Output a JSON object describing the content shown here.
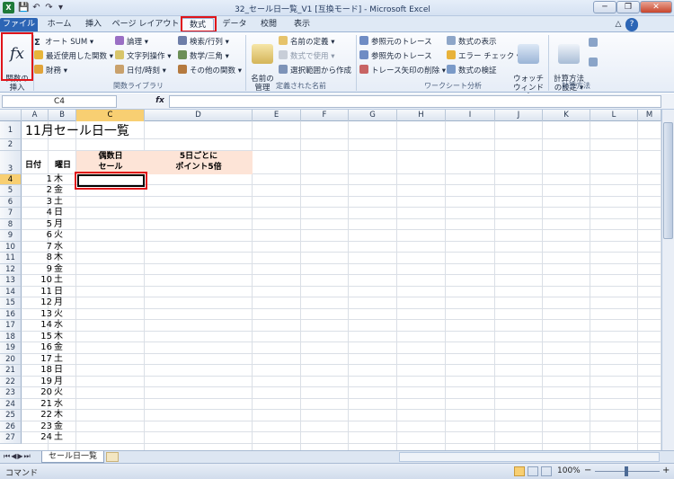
{
  "window": {
    "title": "32_セール日一覧_V1 [互換モード] - Microsoft Excel",
    "app_icon": "X"
  },
  "qat": {
    "save": "💾",
    "undo": "↶",
    "redo": "↷",
    "customize": "▾"
  },
  "window_controls": {
    "help": "?",
    "minimize_ribbon": "△",
    "min": "─",
    "max": "❐",
    "close": "✕"
  },
  "tabs": [
    "ファイル",
    "ホーム",
    "挿入",
    "ページ レイアウト",
    "数式",
    "データ",
    "校閲",
    "表示"
  ],
  "ribbon": {
    "insert_function": "関数の\n挿入",
    "library": {
      "autosum": "オート SUM ▾",
      "recent": "最近使用した関数 ▾",
      "financial": "財務 ▾",
      "logical": "論理 ▾",
      "text": "文字列操作 ▾",
      "datetime": "日付/時刻 ▾",
      "lookup": "検索/行列 ▾",
      "math": "数学/三角 ▾",
      "more": "その他の関数 ▾",
      "label": "関数ライブラリ"
    },
    "names": {
      "manager": "名前の\n管理",
      "define": "名前の定義 ▾",
      "use_in_formula": "数式で使用 ▾",
      "create_from_selection": "選択範囲から作成",
      "label": "定義された名前"
    },
    "auditing": {
      "trace_precedents": "参照元のトレース",
      "trace_dependents": "参照先のトレース",
      "remove_arrows": "トレース矢印の削除 ▾",
      "show_formulas": "数式の表示",
      "error_checking": "エラー チェック ▾",
      "evaluate": "数式の検証",
      "watch": "ウォッチ\nウィンドウ",
      "label": "ワークシート分析"
    },
    "calculation": {
      "options": "計算方法\nの設定 ▾",
      "label": "計算方法"
    }
  },
  "formula_bar": {
    "namebox": "C4",
    "fx": "fx",
    "value": ""
  },
  "columns": [
    "A",
    "B",
    "C",
    "D",
    "E",
    "F",
    "G",
    "H",
    "I",
    "J",
    "K",
    "L",
    "M"
  ],
  "sheet": {
    "title": "11月セール日一覧",
    "headers": {
      "a": "日付",
      "b": "曜日",
      "c": "偶数日\nセール",
      "d": "5日ごとに\nポイント5倍"
    },
    "rows": [
      {
        "day": "1",
        "dow": "木"
      },
      {
        "day": "2",
        "dow": "金"
      },
      {
        "day": "3",
        "dow": "土"
      },
      {
        "day": "4",
        "dow": "日"
      },
      {
        "day": "5",
        "dow": "月"
      },
      {
        "day": "6",
        "dow": "火"
      },
      {
        "day": "7",
        "dow": "水"
      },
      {
        "day": "8",
        "dow": "木"
      },
      {
        "day": "9",
        "dow": "金"
      },
      {
        "day": "10",
        "dow": "土"
      },
      {
        "day": "11",
        "dow": "日"
      },
      {
        "day": "12",
        "dow": "月"
      },
      {
        "day": "13",
        "dow": "火"
      },
      {
        "day": "14",
        "dow": "水"
      },
      {
        "day": "15",
        "dow": "木"
      },
      {
        "day": "16",
        "dow": "金"
      },
      {
        "day": "17",
        "dow": "土"
      },
      {
        "day": "18",
        "dow": "日"
      },
      {
        "day": "19",
        "dow": "月"
      },
      {
        "day": "20",
        "dow": "火"
      },
      {
        "day": "21",
        "dow": "水"
      },
      {
        "day": "22",
        "dow": "木"
      },
      {
        "day": "23",
        "dow": "金"
      },
      {
        "day": "24",
        "dow": "土"
      }
    ]
  },
  "row_numbers": [
    "1",
    "2",
    "3",
    "4",
    "5",
    "6",
    "7",
    "8",
    "9",
    "10",
    "11",
    "12",
    "13",
    "14",
    "15",
    "16",
    "17",
    "18",
    "19",
    "20",
    "21",
    "22",
    "23",
    "24",
    "25",
    "26",
    "27"
  ],
  "sheet_tabs": {
    "active": "セール日一覧",
    "nav": [
      "⏮",
      "◀",
      "▶",
      "⏭"
    ]
  },
  "status": {
    "mode": "コマンド",
    "zoom": "100%",
    "zoom_out": "−",
    "zoom_in": "+"
  },
  "colors": {
    "accent": "#2c65b5",
    "highlight": "#e0141a",
    "header_fill": "#fde4d7",
    "selected_header": "#f8cf72"
  }
}
